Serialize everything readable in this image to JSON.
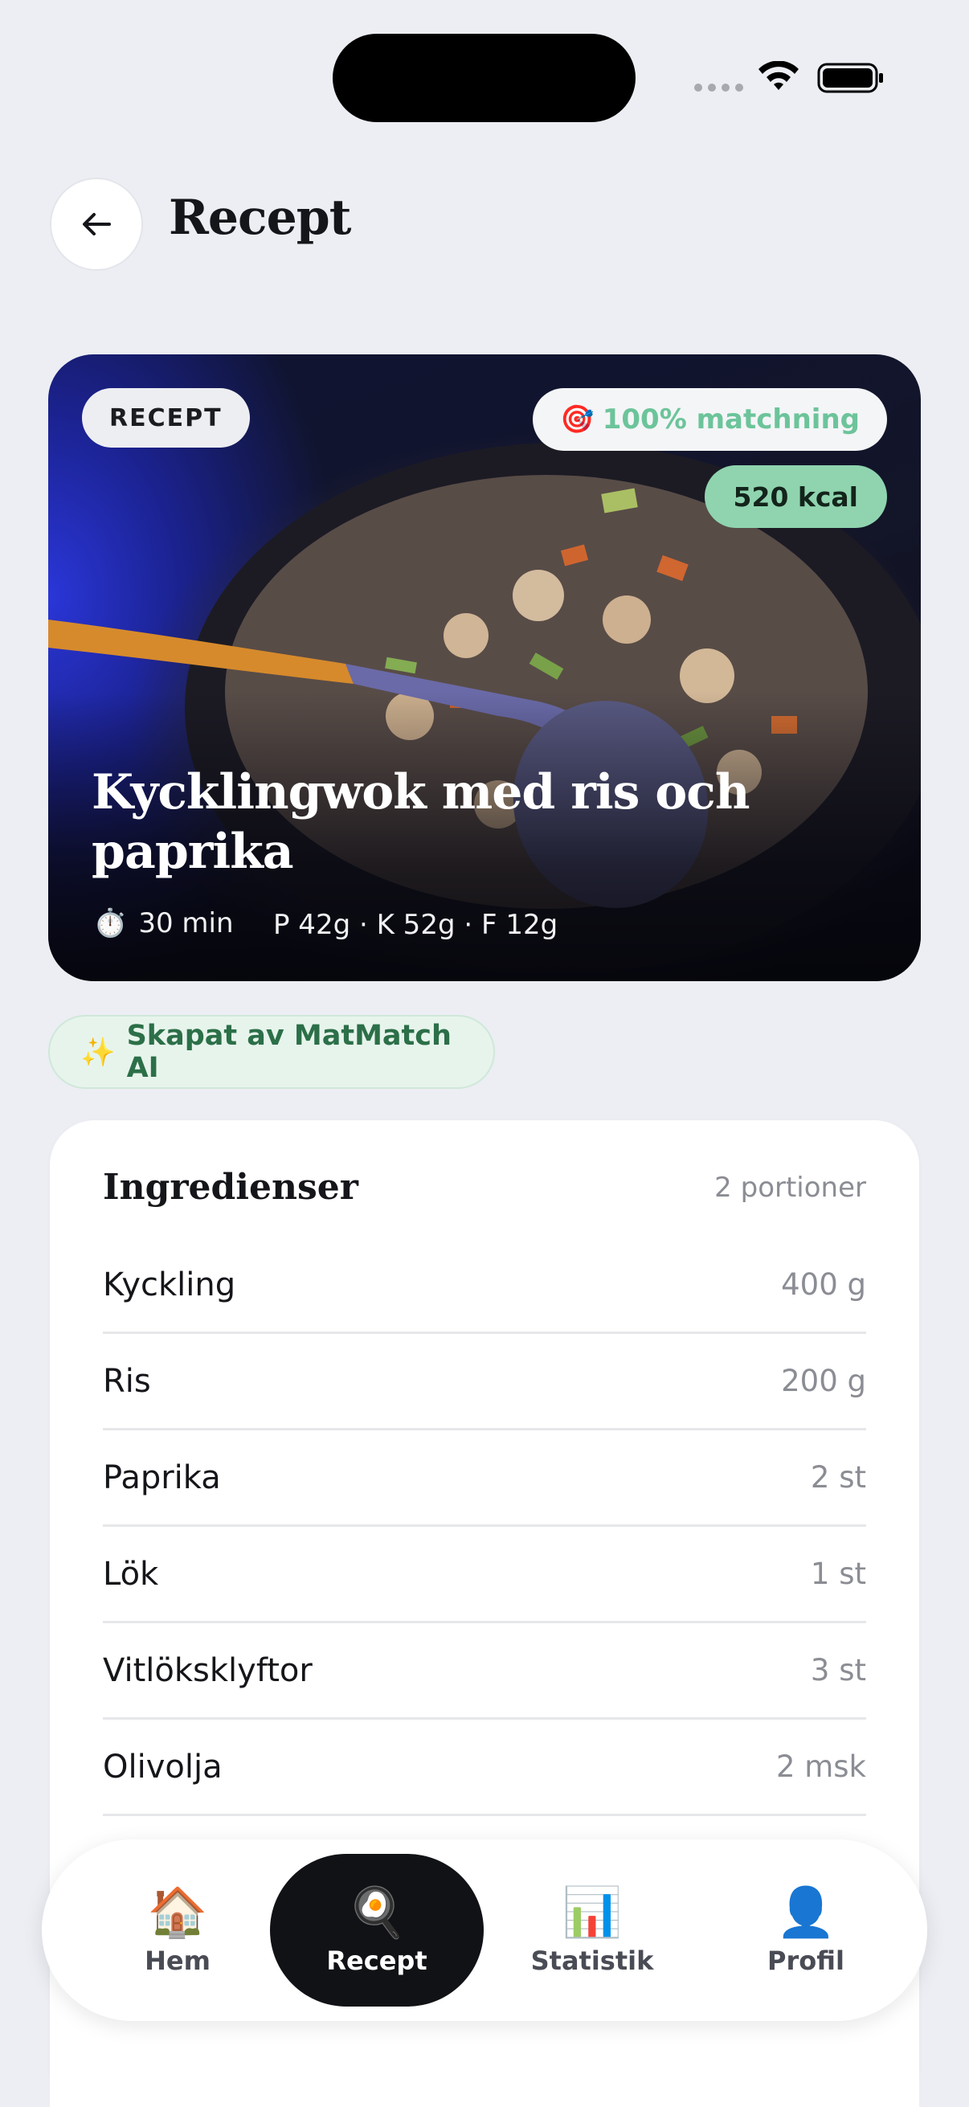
{
  "header": {
    "title": "Recept"
  },
  "hero": {
    "badge": "RECEPT",
    "match_icon": "🎯",
    "match": "100% matchning",
    "kcal": "520 kcal",
    "title": "Kycklingwok med ris och paprika",
    "time_icon": "⏱️",
    "time": "30 min",
    "macros": "P 42g · K 52g · F 12g"
  },
  "ai_badge": {
    "icon": "✨",
    "label": "Skapat av MatMatch AI"
  },
  "ingredients": {
    "title": "Ingredienser",
    "portions": "2 portioner",
    "items": [
      {
        "name": "Kyckling",
        "qty": "400 g"
      },
      {
        "name": "Ris",
        "qty": "200 g"
      },
      {
        "name": "Paprika",
        "qty": "2 st"
      },
      {
        "name": "Lök",
        "qty": "1 st"
      },
      {
        "name": "Vitlöksklyftor",
        "qty": "3 st"
      },
      {
        "name": "Olivolja",
        "qty": "2 msk"
      }
    ]
  },
  "nav": {
    "items": [
      {
        "icon": "🏠",
        "label": "Hem"
      },
      {
        "icon": "🍳",
        "label": "Recept"
      },
      {
        "icon": "📊",
        "label": "Statistik"
      },
      {
        "icon": "👤",
        "label": "Profil"
      }
    ],
    "active_index": 1
  },
  "colors": {
    "accent": "#6cc49a",
    "kcal_bg": "#8fd4af",
    "nav_active": "#111216"
  }
}
